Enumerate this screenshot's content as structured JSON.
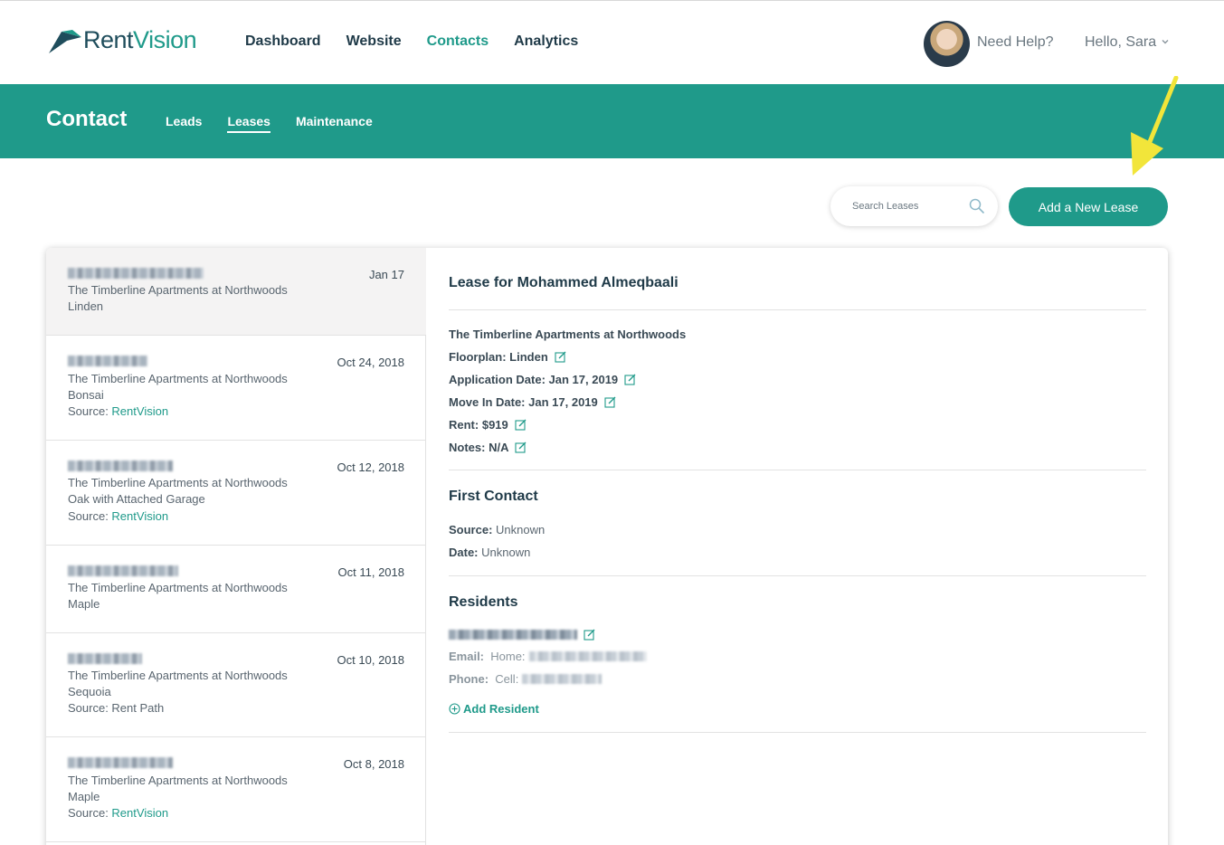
{
  "brand": {
    "logo_text_a": "Rent",
    "logo_text_b": "Vision"
  },
  "nav": {
    "items": [
      "Dashboard",
      "Website",
      "Contacts",
      "Analytics"
    ],
    "active": "Contacts"
  },
  "user": {
    "help": "Need Help?",
    "greeting": "Hello, Sara"
  },
  "subheader": {
    "title": "Contact",
    "tabs": [
      "Leads",
      "Leases",
      "Maintenance"
    ],
    "active": "Leases"
  },
  "search": {
    "placeholder": "Search Leases"
  },
  "actions": {
    "add_lease": "Add a New Lease"
  },
  "leases": [
    {
      "date": "Jan 17",
      "property": "The Timberline Apartments at Northwoods",
      "floorplan": "Linden",
      "source_label": "",
      "source": ""
    },
    {
      "date": "Oct 24, 2018",
      "property": "The Timberline Apartments at Northwoods",
      "floorplan": "Bonsai",
      "source_label": "Source: ",
      "source": "RentVision"
    },
    {
      "date": "Oct 12, 2018",
      "property": "The Timberline Apartments at Northwoods",
      "floorplan": "Oak with Attached Garage",
      "source_label": "Source: ",
      "source": "RentVision"
    },
    {
      "date": "Oct 11, 2018",
      "property": "The Timberline Apartments at Northwoods",
      "floorplan": "Maple",
      "source_label": "",
      "source": ""
    },
    {
      "date": "Oct 10, 2018",
      "property": "The Timberline Apartments at Northwoods",
      "floorplan": "Sequoia",
      "source_label": "Source: Rent Path",
      "source": ""
    },
    {
      "date": "Oct 8, 2018",
      "property": "The Timberline Apartments at Northwoods",
      "floorplan": "Maple",
      "source_label": "Source: ",
      "source": "RentVision"
    }
  ],
  "detail": {
    "title": "Lease for Mohammed Almeqbaali",
    "property": "The Timberline Apartments at Northwoods",
    "floorplan_label": "Floorplan:",
    "floorplan": "Linden",
    "app_date_label": "Application Date:",
    "app_date": "Jan 17, 2019",
    "move_in_label": "Move In Date:",
    "move_in": "Jan 17, 2019",
    "rent_label": "Rent:",
    "rent": "$919",
    "notes_label": "Notes:",
    "notes": "N/A",
    "first_contact": {
      "heading": "First Contact",
      "source_label": "Source:",
      "source": "Unknown",
      "date_label": "Date:",
      "date": "Unknown"
    },
    "residents": {
      "heading": "Residents",
      "email_label": "Email:",
      "email_type": "Home:",
      "phone_label": "Phone:",
      "phone_type": "Cell:",
      "add": "Add Resident"
    }
  },
  "colors": {
    "teal": "#1f9a8a",
    "navy": "#1f3a48",
    "arrow": "#f2e53a"
  }
}
